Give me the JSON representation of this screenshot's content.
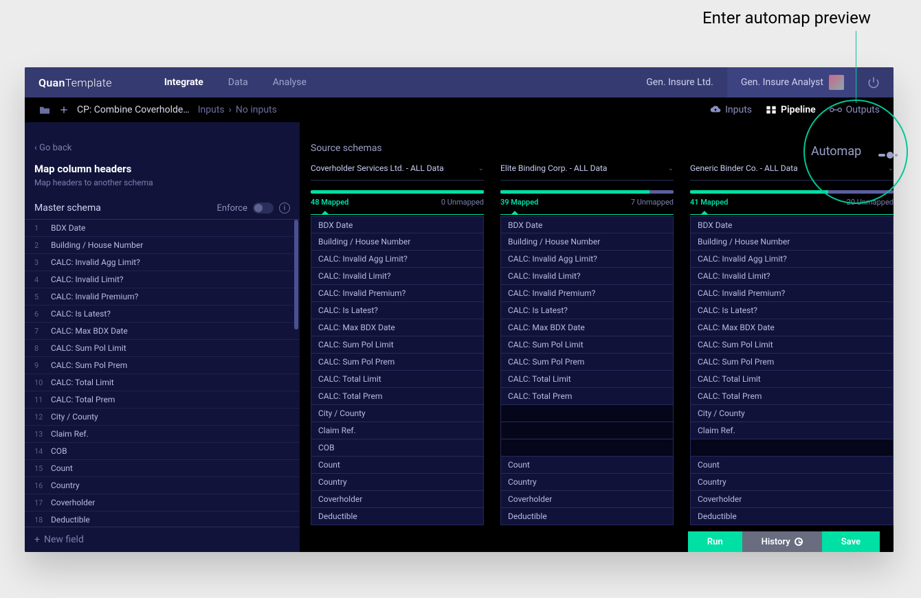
{
  "annotation": {
    "label": "Enter automap preview",
    "button_label": "Automap"
  },
  "topbar": {
    "brand_a": "Quan",
    "brand_b": "Template",
    "tabs": {
      "integrate": "Integrate",
      "data": "Data",
      "analyse": "Analyse"
    },
    "org": "Gen. Insure Ltd.",
    "user": "Gen. Insure Analyst"
  },
  "subbar": {
    "doc_title": "CP: Combine Coverholde…",
    "crumb_a": "Inputs",
    "crumb_b": "No inputs",
    "tabs": {
      "inputs": "Inputs",
      "pipeline": "Pipeline",
      "outputs": "Outputs"
    }
  },
  "leftpanel": {
    "go_back": "Go back",
    "title": "Map column headers",
    "subtitle": "Map headers to another schema",
    "section_title": "Master schema",
    "enforce_label": "Enforce",
    "new_field": "New field",
    "rows": [
      {
        "n": "1",
        "label": "BDX Date"
      },
      {
        "n": "2",
        "label": "Building / House Number"
      },
      {
        "n": "3",
        "label": "CALC: Invalid Agg Limit?"
      },
      {
        "n": "4",
        "label": "CALC: Invalid Limit?"
      },
      {
        "n": "5",
        "label": "CALC: Invalid Premium?"
      },
      {
        "n": "6",
        "label": "CALC: Is Latest?"
      },
      {
        "n": "7",
        "label": "CALC: Max BDX Date"
      },
      {
        "n": "8",
        "label": "CALC: Sum Pol Limit"
      },
      {
        "n": "9",
        "label": "CALC: Sum Pol Prem"
      },
      {
        "n": "10",
        "label": "CALC: Total Limit"
      },
      {
        "n": "11",
        "label": "CALC: Total Prem"
      },
      {
        "n": "12",
        "label": "City / County"
      },
      {
        "n": "13",
        "label": "Claim Ref."
      },
      {
        "n": "14",
        "label": "COB"
      },
      {
        "n": "15",
        "label": "Count"
      },
      {
        "n": "16",
        "label": "Country"
      },
      {
        "n": "17",
        "label": "Coverholder"
      },
      {
        "n": "18",
        "label": "Deductible"
      }
    ]
  },
  "source": {
    "heading": "Source schemas",
    "cols": [
      {
        "name": "Coverholder Services Ltd. - ALL Data",
        "mapped": "48 Mapped",
        "unmapped": "0 Unmapped",
        "pct": 100,
        "items": [
          "BDX Date",
          "Building / House Number",
          "CALC: Invalid Agg Limit?",
          "CALC: Invalid Limit?",
          "CALC: Invalid Premium?",
          "CALC: Is Latest?",
          "CALC: Max BDX Date",
          "CALC: Sum Pol Limit",
          "CALC: Sum Pol Prem",
          "CALC: Total Limit",
          "CALC: Total Prem",
          "City / County",
          "Claim Ref.",
          "COB",
          "Count",
          "Country",
          "Coverholder",
          "Deductible"
        ]
      },
      {
        "name": "Elite Binding Corp. - ALL Data",
        "mapped": "39 Mapped",
        "unmapped": "7 Unmapped",
        "pct": 86,
        "items": [
          "BDX Date",
          "Building / House Number",
          "CALC: Invalid Agg Limit?",
          "CALC: Invalid Limit?",
          "CALC: Invalid Premium?",
          "CALC: Is Latest?",
          "CALC: Max BDX Date",
          "CALC: Sum Pol Limit",
          "CALC: Sum Pol Prem",
          "CALC: Total Limit",
          "CALC: Total Prem",
          "",
          "",
          "",
          "Count",
          "Country",
          "Coverholder",
          "Deductible"
        ]
      },
      {
        "name": "Generic Binder Co. - ALL Data",
        "mapped": "41 Mapped",
        "unmapped": "20 Unmapped",
        "pct": 68,
        "items": [
          "BDX Date",
          "Building / House Number",
          "CALC: Invalid Agg Limit?",
          "CALC: Invalid Limit?",
          "CALC: Invalid Premium?",
          "CALC: Is Latest?",
          "CALC: Max BDX Date",
          "CALC: Sum Pol Limit",
          "CALC: Sum Pol Prem",
          "CALC: Total Limit",
          "CALC: Total Prem",
          "City / County",
          "Claim Ref.",
          "",
          "Count",
          "Country",
          "Coverholder",
          "Deductible"
        ]
      }
    ]
  },
  "actions": {
    "run": "Run",
    "history": "History",
    "save": "Save"
  }
}
